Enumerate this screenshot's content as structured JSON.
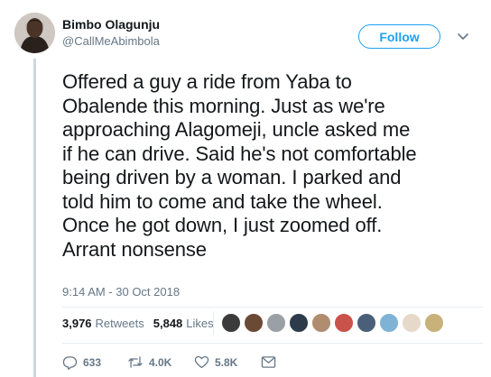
{
  "author": {
    "name": "Bimbo Olagunju",
    "handle": "@CallMeAbimbola"
  },
  "follow_button": "Follow",
  "tweet": {
    "lines": [
      "Offered a guy a ride from Yaba to",
      "Obalende this morning. Just as we're",
      "approaching Alagomeji, uncle asked me",
      "if he can drive. Said he's not comfortable",
      "being driven by a woman. I parked and",
      "told him to come and take the wheel.",
      "Once he got down, I just zoomed off.",
      "Arrant nonsense"
    ],
    "timestamp": "9:14 AM - 30 Oct 2018"
  },
  "stats": {
    "retweets_count": "3,976",
    "retweets_label": "Retweets",
    "likes_count": "5,848",
    "likes_label": "Likes"
  },
  "actions": {
    "replies": "633",
    "retweets": "4.0K",
    "likes": "5.8K"
  },
  "icons": {
    "avatar": "profile-photo",
    "caret": "chevron-down-icon",
    "reply": "reply-icon",
    "retweet": "retweet-icon",
    "like": "heart-icon",
    "message": "envelope-icon"
  },
  "colors": {
    "accent": "#1da1f2",
    "secondary_text": "#657786",
    "primary_text": "#14171a",
    "border": "#e6ecf0"
  }
}
